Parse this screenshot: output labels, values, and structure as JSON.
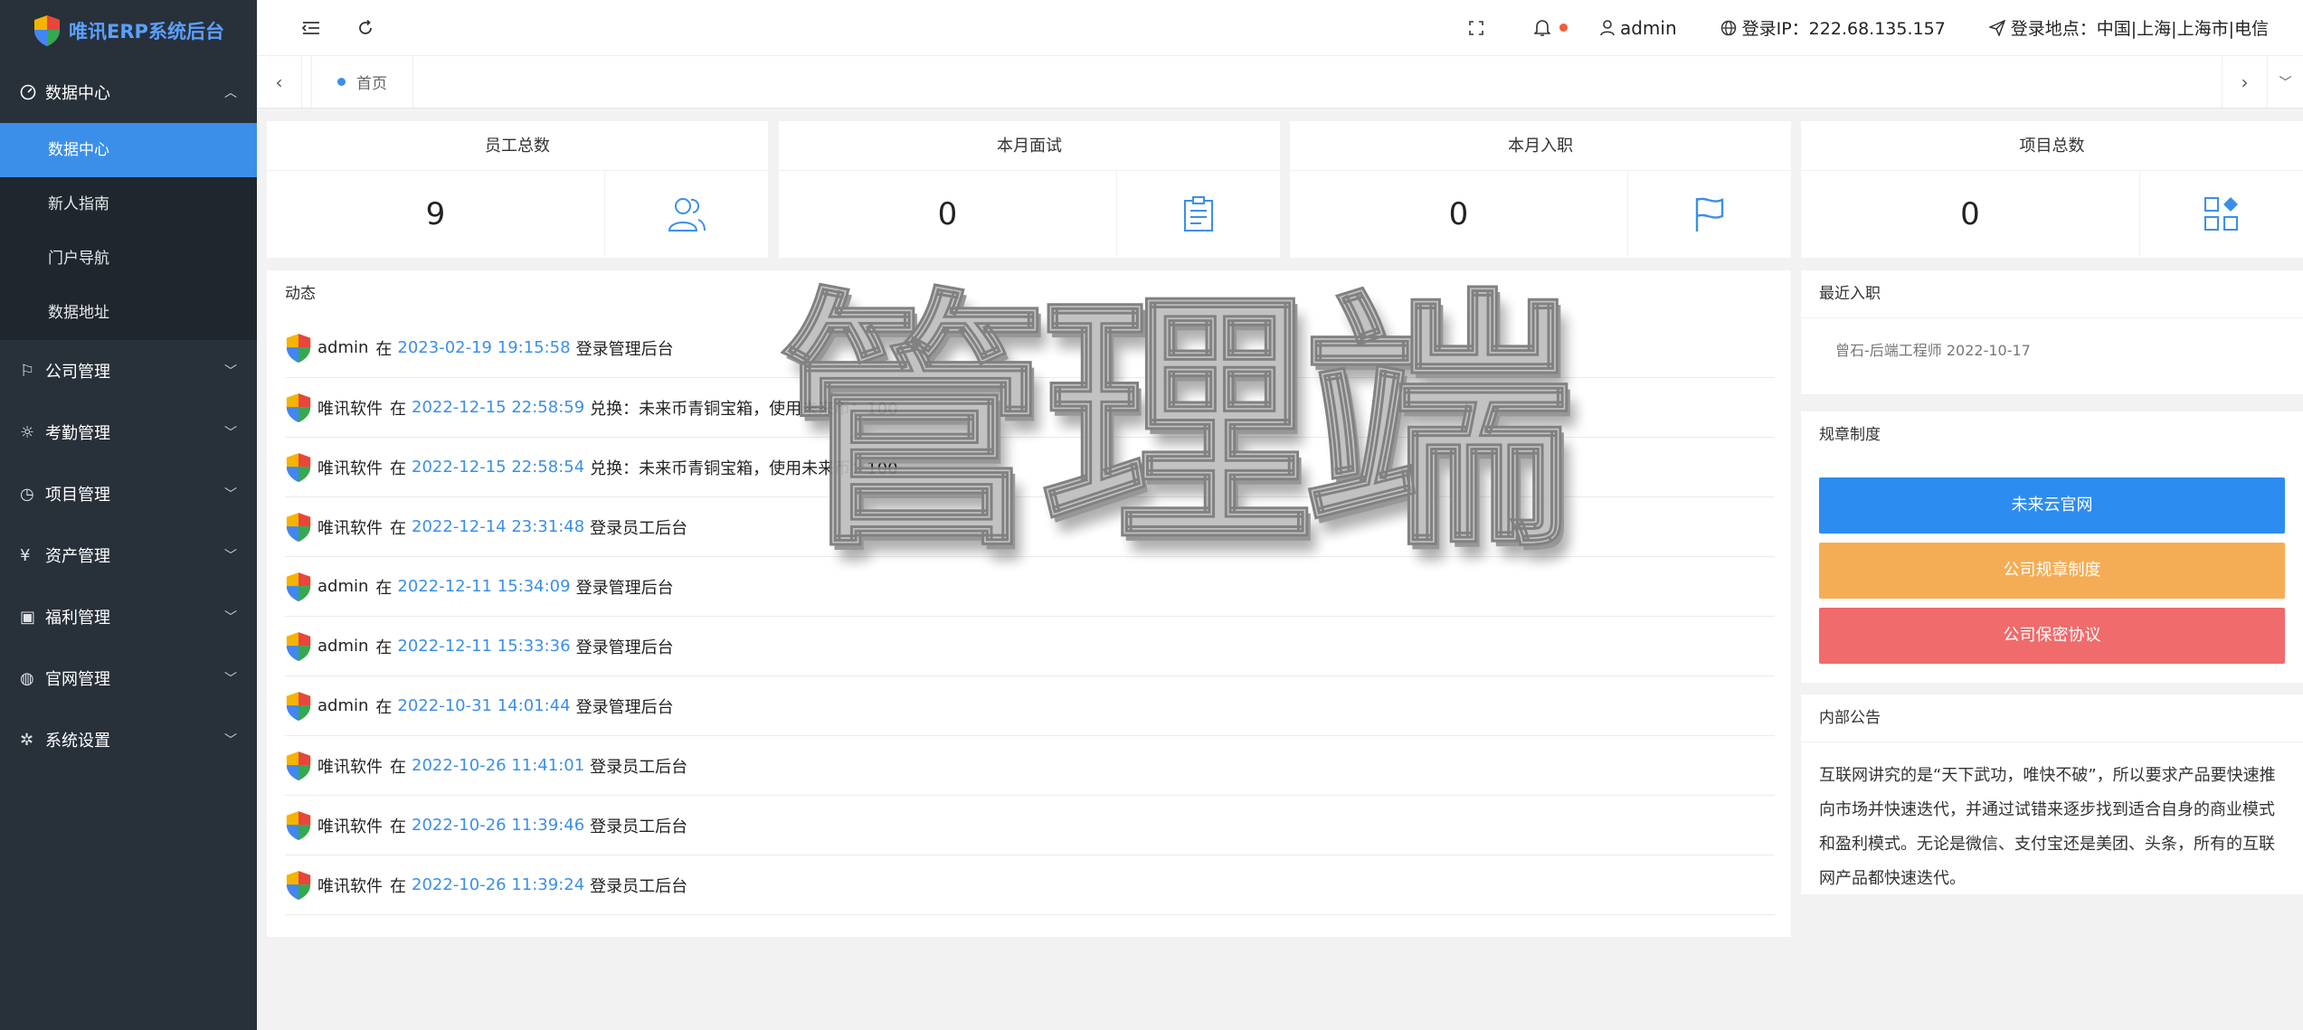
{
  "app": {
    "logo_text": "唯讯ERP系统后台"
  },
  "sidebar": {
    "groups": [
      {
        "label": "数据中心",
        "icon": "dashboard-icon",
        "expanded": true,
        "items": [
          {
            "label": "数据中心",
            "active": true
          },
          {
            "label": "新人指南"
          },
          {
            "label": "门户导航"
          },
          {
            "label": "数据地址"
          }
        ]
      },
      {
        "label": "公司管理",
        "icon": "flag-icon"
      },
      {
        "label": "考勤管理",
        "icon": "gear-sun-icon"
      },
      {
        "label": "项目管理",
        "icon": "clock-icon"
      },
      {
        "label": "资产管理",
        "icon": "yen-icon"
      },
      {
        "label": "福利管理",
        "icon": "gift-icon"
      },
      {
        "label": "官网管理",
        "icon": "globe-icon"
      },
      {
        "label": "系统设置",
        "icon": "settings-icon"
      }
    ]
  },
  "header": {
    "user": "admin",
    "login_ip": "登录IP：222.68.135.157",
    "login_location": "登录地点：中国|上海|上海市|电信"
  },
  "tabs": [
    {
      "label": "首页"
    }
  ],
  "stats": [
    {
      "title": "员工总数",
      "value": "9",
      "icon": "users-icon"
    },
    {
      "title": "本月面试",
      "value": "0",
      "icon": "clipboard-icon"
    },
    {
      "title": "本月入职",
      "value": "0",
      "icon": "flag-icon"
    },
    {
      "title": "项目总数",
      "value": "0",
      "icon": "grid-icon"
    }
  ],
  "feed": {
    "title": "动态",
    "connector": "在",
    "rows": [
      {
        "user": "admin",
        "time": "2023-02-19 19:15:58",
        "action": "登录管理后台"
      },
      {
        "user": "唯讯软件",
        "time": "2022-12-15 22:58:59",
        "action": "兑换：未来币青铜宝箱，使用未来币：100"
      },
      {
        "user": "唯讯软件",
        "time": "2022-12-15 22:58:54",
        "action": "兑换：未来币青铜宝箱，使用未来币：100"
      },
      {
        "user": "唯讯软件",
        "time": "2022-12-14 23:31:48",
        "action": "登录员工后台"
      },
      {
        "user": "admin",
        "time": "2022-12-11 15:34:09",
        "action": "登录管理后台"
      },
      {
        "user": "admin",
        "time": "2022-12-11 15:33:36",
        "action": "登录管理后台"
      },
      {
        "user": "admin",
        "time": "2022-10-31 14:01:44",
        "action": "登录管理后台"
      },
      {
        "user": "唯讯软件",
        "time": "2022-10-26 11:41:01",
        "action": "登录员工后台"
      },
      {
        "user": "唯讯软件",
        "time": "2022-10-26 11:39:46",
        "action": "登录员工后台"
      },
      {
        "user": "唯讯软件",
        "time": "2022-10-26 11:39:24",
        "action": "登录员工后台"
      }
    ]
  },
  "recent_hire": {
    "title": "最近入职",
    "entry": "曾石-后端工程师 2022-10-17"
  },
  "rules": {
    "title": "规章制度",
    "buttons": [
      {
        "label": "未来云官网",
        "color": "#2d8cf0"
      },
      {
        "label": "公司规章制度",
        "color": "#f5ad55"
      },
      {
        "label": "公司保密协议",
        "color": "#f06b6b"
      }
    ]
  },
  "notice": {
    "title": "内部公告",
    "text": "互联网讲究的是“天下武功，唯快不破”，所以要求产品要快速推向市场并快速迭代，并通过试错来逐步找到适合自身的商业模式和盈利模式。无论是微信、支付宝还是美团、头条，所有的互联网产品都快速迭代。"
  },
  "watermark": "管理端"
}
